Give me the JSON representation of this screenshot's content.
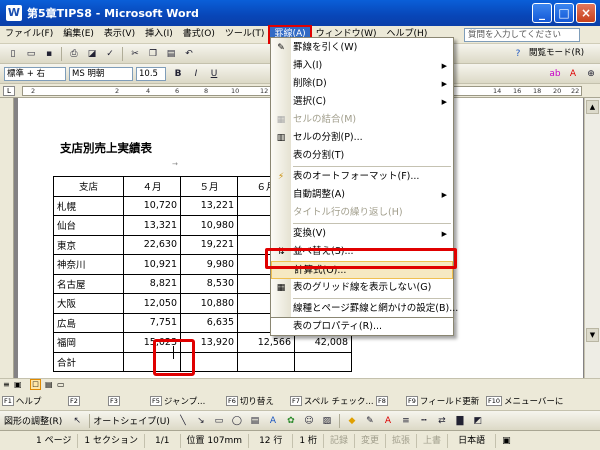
{
  "window": {
    "title": "第5章TIPS8 - Microsoft Word",
    "app_icon": "W"
  },
  "menubar": {
    "items": [
      "ファイル(F)",
      "編集(E)",
      "表示(V)",
      "挿入(I)",
      "書式(O)",
      "ツール(T)",
      "罫線(A)",
      "ウィンドウ(W)",
      "ヘルプ(H)"
    ],
    "active": "罫線(A)",
    "help_placeholder": "質問を入力してください"
  },
  "toolbar": {
    "style": "標準 + 右",
    "font": "MS 明朝",
    "size": "10.5",
    "reading_mode": "閲覧モード(R)"
  },
  "ruler": {
    "ticks": [
      "2",
      "2",
      "4",
      "6",
      "8",
      "10",
      "12",
      "14",
      "16",
      "18",
      "20",
      "22"
    ]
  },
  "document": {
    "heading": "支店別売上実績表",
    "headers": [
      "支店",
      "４月",
      "５月",
      "６月",
      ""
    ],
    "rows": [
      [
        "札幌",
        "10,720",
        "13,221",
        "",
        ""
      ],
      [
        "仙台",
        "13,321",
        "10,980",
        "",
        ""
      ],
      [
        "東京",
        "22,630",
        "19,221",
        "",
        ""
      ],
      [
        "神奈川",
        "10,921",
        "9,980",
        "",
        ""
      ],
      [
        "名古屋",
        "8,821",
        "8,530",
        "",
        ""
      ],
      [
        "大阪",
        "12,050",
        "10,880",
        "",
        ""
      ],
      [
        "広島",
        "7,751",
        "6,635",
        "",
        ""
      ],
      [
        "福岡",
        "15,023",
        "13,920",
        "12,566",
        "42,008"
      ],
      [
        "合計",
        "",
        "",
        "",
        ""
      ]
    ]
  },
  "table_menu": {
    "items": [
      {
        "label": "罫線を引く(W)",
        "icon": "pencil-icon",
        "enabled": true,
        "submenu": false
      },
      {
        "label": "挿入(I)",
        "enabled": true,
        "submenu": true
      },
      {
        "label": "削除(D)",
        "enabled": true,
        "submenu": true
      },
      {
        "label": "選択(C)",
        "enabled": true,
        "submenu": true
      },
      {
        "label": "セルの結合(M)",
        "icon": "merge-cells-icon",
        "enabled": false,
        "submenu": false
      },
      {
        "label": "セルの分割(P)...",
        "icon": "split-cells-icon",
        "enabled": true,
        "submenu": false
      },
      {
        "label": "表の分割(T)",
        "enabled": true,
        "submenu": false
      },
      {
        "label": "表のオートフォーマット(F)...",
        "icon": "autoformat-icon",
        "enabled": true,
        "submenu": false
      },
      {
        "label": "自動調整(A)",
        "enabled": true,
        "submenu": true
      },
      {
        "label": "タイトル行の繰り返し(H)",
        "enabled": false,
        "submenu": false
      },
      {
        "label": "変換(V)",
        "enabled": true,
        "submenu": true
      },
      {
        "label": "並べ替え(S)...",
        "icon": "sort-icon",
        "enabled": true,
        "submenu": false
      },
      {
        "label": "計算式(O)...",
        "enabled": true,
        "submenu": false,
        "highlighted": true
      },
      {
        "label": "表のグリッド線を表示しない(G)",
        "icon": "grid-icon",
        "enabled": true,
        "submenu": false
      },
      {
        "label": "線種とページ罫線と網かけの設定(B)...",
        "enabled": true,
        "submenu": false
      },
      {
        "label": "表のプロパティ(R)...",
        "enabled": true,
        "submenu": false
      }
    ]
  },
  "function_keys": [
    {
      "key": "F1",
      "label": "ヘルプ"
    },
    {
      "key": "F2",
      "label": ""
    },
    {
      "key": "F3",
      "label": ""
    },
    {
      "key": "F5",
      "label": "ジャンプ..."
    },
    {
      "key": "F6",
      "label": "切り替え"
    },
    {
      "key": "F7",
      "label": "スペル チェック..."
    },
    {
      "key": "F8",
      "label": ""
    },
    {
      "key": "F9",
      "label": "フィールド更新"
    },
    {
      "key": "F10",
      "label": "メニューバーに"
    }
  ],
  "drawbar": {
    "draw": "図形の調整(R)",
    "autoshapes": "オートシェイプ(U)"
  },
  "status": {
    "page": "1 ページ",
    "section": "1 セクション",
    "pages": "1/1",
    "position": "位置 107mm",
    "line": "12 行",
    "column": "1 桁",
    "rec": "記録",
    "trk": "変更",
    "ext": "拡張",
    "ovr": "上書",
    "language": "日本語"
  }
}
